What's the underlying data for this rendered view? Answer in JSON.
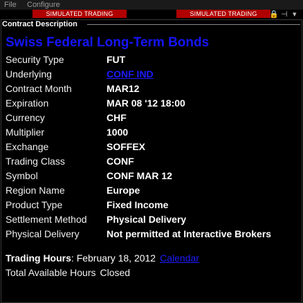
{
  "menubar": {
    "file": "File",
    "configure": "Configure"
  },
  "banner": {
    "left": "SIMULATED TRADING",
    "right": "SIMULATED TRADING"
  },
  "window_controls": {
    "lock": "🔒",
    "pin": "⊣",
    "close": "▾"
  },
  "section_header": "Contract Description",
  "title": "Swiss Federal Long-Term Bonds",
  "fields": [
    {
      "label": "Security Type",
      "value": "FUT"
    },
    {
      "label": "Underlying",
      "value": "CONF IND"
    },
    {
      "label": "Contract Month",
      "value": "MAR12"
    },
    {
      "label": "Expiration",
      "value": "MAR 08 '12 18:00"
    },
    {
      "label": "Currency",
      "value": "CHF"
    },
    {
      "label": "Multiplier",
      "value": "1000"
    },
    {
      "label": "Exchange",
      "value": "SOFFEX"
    },
    {
      "label": "Trading Class",
      "value": "CONF"
    },
    {
      "label": "Symbol",
      "value": "CONF MAR 12"
    },
    {
      "label": "Region Name",
      "value": "Europe"
    },
    {
      "label": "Product Type",
      "value": "Fixed Income"
    },
    {
      "label": "Settlement Method",
      "value": "Physical Delivery"
    },
    {
      "label": "Physical Delivery",
      "value": "Not permitted at Interactive Brokers"
    }
  ],
  "trading_hours": {
    "label": "Trading Hours",
    "date": "February 18, 2012",
    "calendar_link": "Calendar"
  },
  "available": {
    "label": "Total Available Hours",
    "value": "Closed"
  },
  "colors": {
    "link": "#1b1bff",
    "title": "#1515ff",
    "banner": "#b00000",
    "background": "#000000"
  }
}
